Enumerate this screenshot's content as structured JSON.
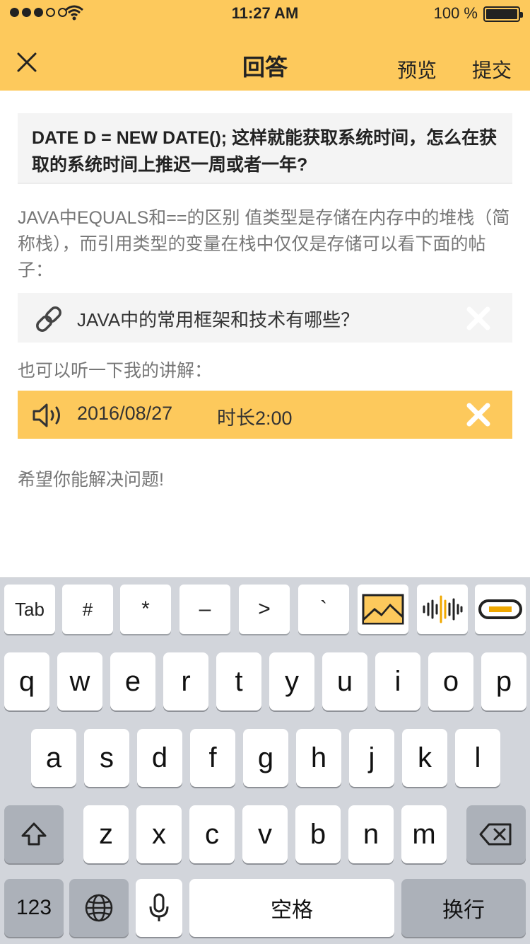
{
  "status_bar": {
    "time": "11:27 AM",
    "battery": "100 %"
  },
  "header": {
    "title": "回答",
    "preview_label": "预览",
    "submit_label": "提交"
  },
  "question": {
    "text": "DATE D = NEW DATE(); 这样就能获取系统时间，怎么在获取的系统时间上推迟一周或者一年?"
  },
  "answer": {
    "body": "JAVA中EQUALS和==的区别 值类型是存储在内存中的堆栈（简称栈），而引用类型的变量在栈中仅仅是存储可以看下面的帖子：",
    "link_title": "JAVA中的常用框架和技术有哪些？",
    "listen_prompt": "也可以听一下我的讲解：",
    "audio_date": "2016/08/27",
    "audio_duration": "时长2:00",
    "closing": "希望你能解决问题!"
  },
  "keyboard": {
    "toolbar": [
      "Tab",
      "#",
      "*",
      "–",
      ">",
      "`"
    ],
    "row1": [
      "q",
      "w",
      "e",
      "r",
      "t",
      "y",
      "u",
      "i",
      "o",
      "p"
    ],
    "row2": [
      "a",
      "s",
      "d",
      "f",
      "g",
      "h",
      "j",
      "k",
      "l"
    ],
    "row3": [
      "z",
      "x",
      "c",
      "v",
      "b",
      "n",
      "m"
    ],
    "num_label": "123",
    "space_label": "空格",
    "return_label": "换行"
  },
  "colors": {
    "accent": "#FDC95C",
    "keyboard_bg": "#D2D5DB"
  }
}
